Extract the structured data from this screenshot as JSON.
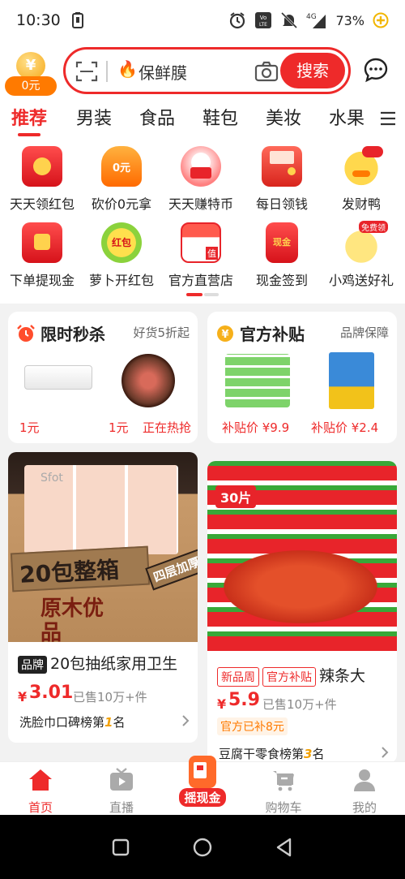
{
  "status": {
    "time": "10:30",
    "battery": "73%",
    "network": "4G"
  },
  "header": {
    "coin_value": "¥",
    "coin_label": "0元",
    "search_placeholder": "保鲜膜",
    "search_button": "搜索"
  },
  "tabs": [
    "推荐",
    "男装",
    "食品",
    "鞋包",
    "美妆",
    "水果"
  ],
  "grid": [
    {
      "label": "天天领红包",
      "icon": "red-envelope-icon"
    },
    {
      "label": "砍价0元拿",
      "icon": "bargain-bag-icon",
      "icon_text": "0元"
    },
    {
      "label": "天天赚特币",
      "icon": "cat-coin-icon"
    },
    {
      "label": "每日领钱",
      "icon": "wallet-icon"
    },
    {
      "label": "发财鸭",
      "icon": "duck-icon"
    },
    {
      "label": "下单提现金",
      "icon": "cash-envelope-icon"
    },
    {
      "label": "萝卜开红包",
      "icon": "radish-envelope-icon",
      "icon_text": "红包"
    },
    {
      "label": "官方直营店",
      "icon": "store-icon",
      "icon_text": "值"
    },
    {
      "label": "现金签到",
      "icon": "cash-sign-icon",
      "icon_text": "现金"
    },
    {
      "label": "小鸡送好礼",
      "icon": "chick-gift-icon",
      "icon_text": "免费领"
    }
  ],
  "promo_left": {
    "title": "限时秒杀",
    "subtitle": "好货5折起",
    "items": [
      {
        "price": "1元"
      },
      {
        "price": "1元",
        "note": "正在热抢"
      }
    ]
  },
  "promo_right": {
    "title": "官方补贴",
    "subtitle": "品牌保障",
    "items": [
      {
        "price": "补贴价 ¥9.9"
      },
      {
        "price": "补贴价 ¥2.4"
      }
    ]
  },
  "cards": [
    {
      "badge": "品牌",
      "name": "20包抽纸家用卫生",
      "price_symbol": "¥",
      "price": "3.01",
      "sold": "已售10万+件",
      "rank_prefix": "洗脸巾口碑榜第",
      "rank_num": "1",
      "rank_suffix": "名",
      "img_text": "20包整箱",
      "img_text2": "四层加厚",
      "img_text3": "原木优品",
      "brand_text": "Sfot"
    },
    {
      "badge1": "新品周",
      "badge2": "官方补贴",
      "name": "辣条大",
      "price_symbol": "¥",
      "price": "5.9",
      "sold": "已售10万+件",
      "subsidy": "官方已补8元",
      "rank_prefix": "豆腐干零食榜第",
      "rank_num": "3",
      "rank_suffix": "名",
      "img_badge": "30片"
    }
  ],
  "bottom_nav": [
    {
      "label": "首页",
      "icon": "home-icon"
    },
    {
      "label": "直播",
      "icon": "live-tv-icon"
    },
    {
      "label": "摇现金",
      "icon": "shake-cash-icon"
    },
    {
      "label": "购物车",
      "icon": "cart-icon"
    },
    {
      "label": "我的",
      "icon": "profile-icon"
    }
  ],
  "colors": {
    "accent": "#ee2a2a",
    "orange": "#ff7a00"
  }
}
